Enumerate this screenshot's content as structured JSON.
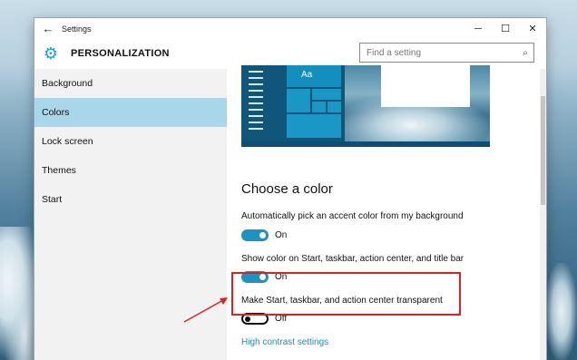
{
  "window": {
    "title": "Settings",
    "back_icon": "back-arrow-icon",
    "controls": {
      "minimize": "─",
      "maximize": "☐",
      "close": "✕"
    }
  },
  "header": {
    "icon": "gear-icon",
    "title": "PERSONALIZATION",
    "search_placeholder": "Find a setting",
    "search_icon": "search-icon"
  },
  "sidebar": {
    "items": [
      {
        "label": "Background",
        "selected": false
      },
      {
        "label": "Colors",
        "selected": true
      },
      {
        "label": "Lock screen",
        "selected": false
      },
      {
        "label": "Themes",
        "selected": false
      },
      {
        "label": "Start",
        "selected": false
      }
    ]
  },
  "preview": {
    "tile_label": "Aa"
  },
  "content": {
    "section_title": "Choose a color",
    "settings": [
      {
        "label": "Automatically pick an accent color from my background",
        "state": "On"
      },
      {
        "label": "Show color on Start, taskbar, action center, and title bar",
        "state": "On"
      },
      {
        "label": "Make Start, taskbar, and action center transparent",
        "state": "Off"
      }
    ],
    "link": "High contrast settings"
  },
  "colors": {
    "accent": "#1d93c4",
    "selected_nav": "#a9d7ea",
    "annotation": "#e02020"
  }
}
